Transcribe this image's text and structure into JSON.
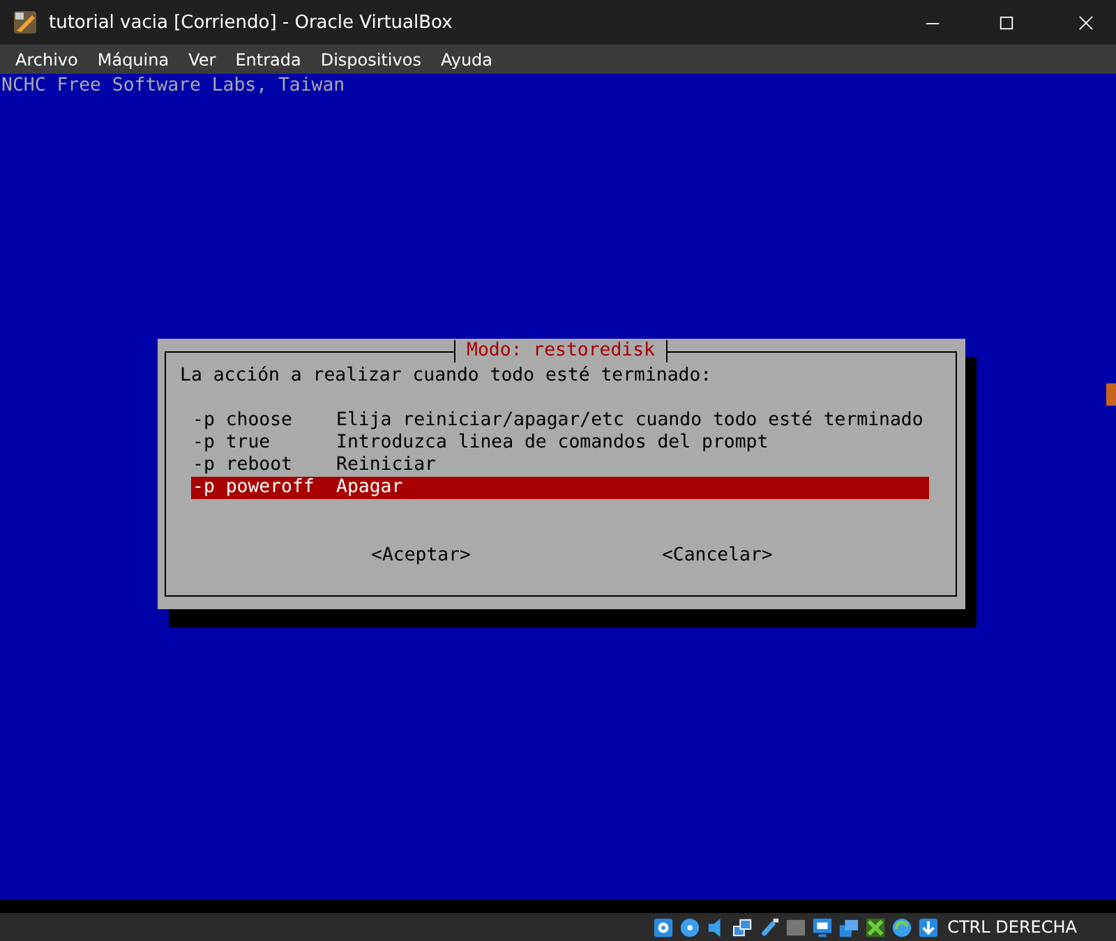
{
  "window": {
    "title": "tutorial vacia [Corriendo] - Oracle VirtualBox"
  },
  "menu": [
    "Archivo",
    "Máquina",
    "Ver",
    "Entrada",
    "Dispositivos",
    "Ayuda"
  ],
  "console": {
    "header": "NCHC Free Software Labs, Taiwan"
  },
  "dialog": {
    "title": "Modo: restoredisk",
    "prompt": "La acción a realizar cuando todo esté terminado:",
    "options": [
      {
        "flag": "-p choose",
        "description": "Elija reiniciar/apagar/etc cuando todo esté terminado",
        "selected": false
      },
      {
        "flag": "-p true",
        "description": "Introduzca linea de comandos del prompt",
        "selected": false
      },
      {
        "flag": "-p reboot",
        "description": "Reiniciar",
        "selected": false
      },
      {
        "flag": "-p poweroff",
        "description": "Apagar",
        "selected": true
      }
    ],
    "buttons": [
      "<Aceptar>",
      "<Cancelar>"
    ]
  },
  "status_bar": {
    "host_key": "CTRL DERECHA"
  }
}
